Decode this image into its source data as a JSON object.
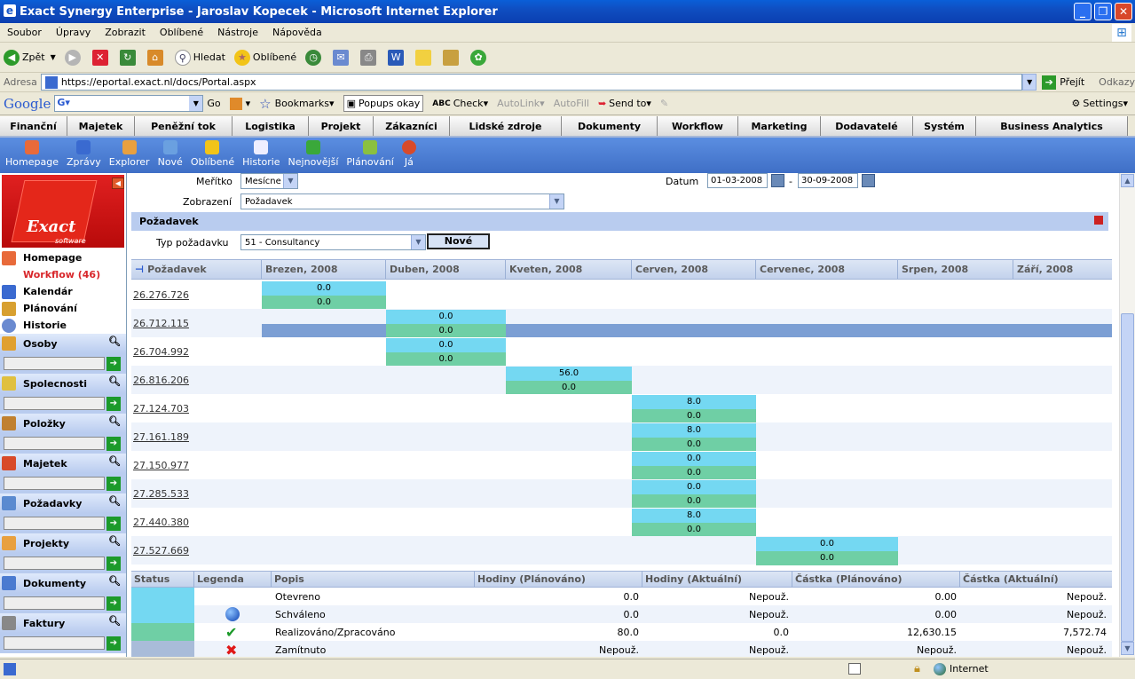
{
  "window": {
    "title": "Exact Synergy Enterprise - Jaroslav Kopecek - Microsoft Internet Explorer"
  },
  "menu": [
    "Soubor",
    "Úpravy",
    "Zobrazit",
    "Oblíbené",
    "Nástroje",
    "Nápověda"
  ],
  "toolbar": {
    "back": "Zpět",
    "search": "Hledat",
    "favorites": "Oblíbené"
  },
  "address": {
    "label": "Adresa",
    "url": "https://eportal.exact.nl/docs/Portal.aspx",
    "go": "Přejít",
    "links": "Odkazy"
  },
  "google": {
    "logo": "Google",
    "go": "Go",
    "bookmarks": "Bookmarks",
    "popups": "Popups okay",
    "check": "Check",
    "autolink": "AutoLink",
    "autofill": "AutoFill",
    "sendto": "Send to",
    "settings": "Settings"
  },
  "topnav": [
    "Finanční",
    "Majetek",
    "Peněžní tok",
    "Logistika",
    "Projekt",
    "Zákazníci",
    "Lidské zdroje",
    "Dokumenty",
    "Workflow",
    "Marketing",
    "Dodavatelé",
    "Systém",
    "Business Analytics"
  ],
  "iconbar": [
    "Homepage",
    "Zprávy",
    "Explorer",
    "Nové",
    "Oblíbené",
    "Historie",
    "Nejnovější",
    "Plánování",
    "Já"
  ],
  "sidebar": {
    "logo": "Exact",
    "logo_sub": "software",
    "nav": [
      "Homepage",
      "Workflow (46)",
      "Kalendár",
      "Plánování",
      "Historie"
    ],
    "groups": [
      "Osoby",
      "Spolecnosti",
      "Položky",
      "Majetek",
      "Požadavky",
      "Projekty",
      "Dokumenty",
      "Faktury"
    ],
    "go": "➔"
  },
  "filters": {
    "scale_label": "Meřítko",
    "scale_value": "Mesícne",
    "date_label": "Datum",
    "date_from": "01-03-2008",
    "date_sep": "-",
    "date_to": "30-09-2008",
    "view_label": "Zobrazení",
    "view_value": "Požadavek",
    "section": "Požadavek",
    "type_label": "Typ požadavku",
    "type_value": "51 - Consultancy",
    "new_button": "Nové"
  },
  "grid": {
    "columns": [
      "Požadavek",
      "Brezen, 2008",
      "Duben, 2008",
      "Kveten, 2008",
      "Cerven, 2008",
      "Cervenec, 2008",
      "Srpen, 2008",
      "Září, 2008"
    ],
    "rows": [
      {
        "id": "26.276.726",
        "top": "0.0",
        "bottom": "0.0"
      },
      {
        "id": "26.712.115",
        "top": "0.0",
        "bottom": "0.0"
      },
      {
        "id": "26.704.992",
        "top": "0.0",
        "bottom": "0.0"
      },
      {
        "id": "26.816.206",
        "top": "56.0",
        "bottom": "0.0"
      },
      {
        "id": "27.124.703",
        "top": "8.0",
        "bottom": "0.0"
      },
      {
        "id": "27.161.189",
        "top": "8.0",
        "bottom": "0.0"
      },
      {
        "id": "27.150.977",
        "top": "0.0",
        "bottom": "0.0"
      },
      {
        "id": "27.285.533",
        "top": "0.0",
        "bottom": "0.0"
      },
      {
        "id": "27.440.380",
        "top": "8.0",
        "bottom": "0.0"
      },
      {
        "id": "27.527.669",
        "top": "0.0",
        "bottom": "0.0"
      }
    ]
  },
  "legend": {
    "headers": [
      "Status",
      "Legenda",
      "Popis",
      "Hodiny (Plánováno)",
      "Hodiny (Aktuální)",
      "Částka (Plánováno)",
      "Částka (Aktuální)"
    ],
    "rows": [
      {
        "popis": "Otevreno",
        "hp": "0.0",
        "ha": "Nepouž.",
        "cp": "0.00",
        "ca": "Nepouž.",
        "color": "#74d8f2",
        "icon": "none"
      },
      {
        "popis": "Schváleno",
        "hp": "0.0",
        "ha": "Nepouž.",
        "cp": "0.00",
        "ca": "Nepouž.",
        "color": "#74d8f2",
        "icon": "blue-globe-icon"
      },
      {
        "popis": "Realizováno/Zpracováno",
        "hp": "80.0",
        "ha": "0.0",
        "cp": "12,630.15",
        "ca": "7,572.74",
        "color": "#6fcfa5",
        "icon": "check-icon"
      },
      {
        "popis": "Zamítnuto",
        "hp": "Nepouž.",
        "ha": "Nepouž.",
        "cp": "Nepouž.",
        "ca": "Nepouž.",
        "color": "#a9bcd9",
        "icon": "x-icon"
      }
    ]
  },
  "status": {
    "zone": "Internet"
  },
  "colors": {
    "planned": "#74d8f2",
    "actual": "#6fcfa5",
    "rejected": "#a9bcd9",
    "highlight": "#7c9fd4",
    "header": "#b9ccef"
  }
}
